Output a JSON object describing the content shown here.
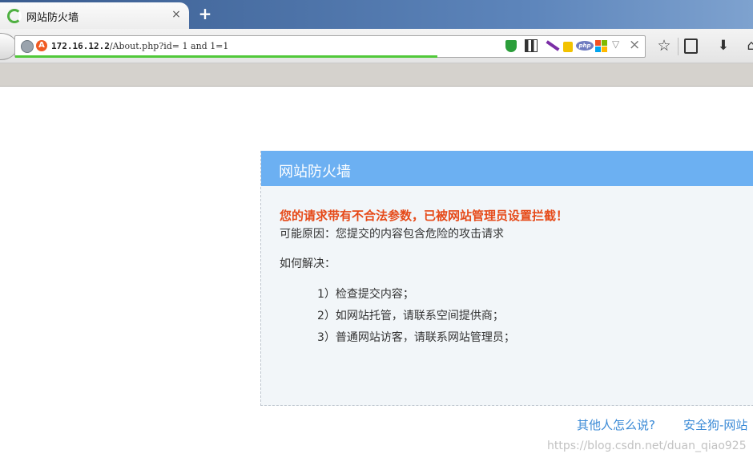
{
  "browser": {
    "tab_title": "网站防火墙",
    "tab_close": "×",
    "new_tab": "+",
    "url_host": "172.16.12.2",
    "url_path": "/About.php?id= 1 and 1=1",
    "url_dropdown": "▽",
    "url_clear": "×",
    "php_label": "php",
    "badge_letter": "A",
    "load_progress": 0.67
  },
  "page": {
    "panel_title": "网站防火墙",
    "alert": "您的请求带有不合法参数，已被网站管理员设置拦截！",
    "reason": "可能原因：您提交的内容包含危险的攻击请求",
    "howto": "如何解决：",
    "steps": [
      "1）检查提交内容；",
      "2）如网站托管，请联系空间提供商；",
      "3）普通网站访客，请联系网站管理员；"
    ],
    "footer_link_1": "其他人怎么说?",
    "footer_link_2": "安全狗-网站"
  },
  "watermark": "https://blog.csdn.net/duan_qiao925",
  "colors": {
    "header_blue": "#6cb0f2",
    "alert_red": "#e64a19",
    "link_blue": "#3a8ad6",
    "progress_green": "#51c93a"
  }
}
